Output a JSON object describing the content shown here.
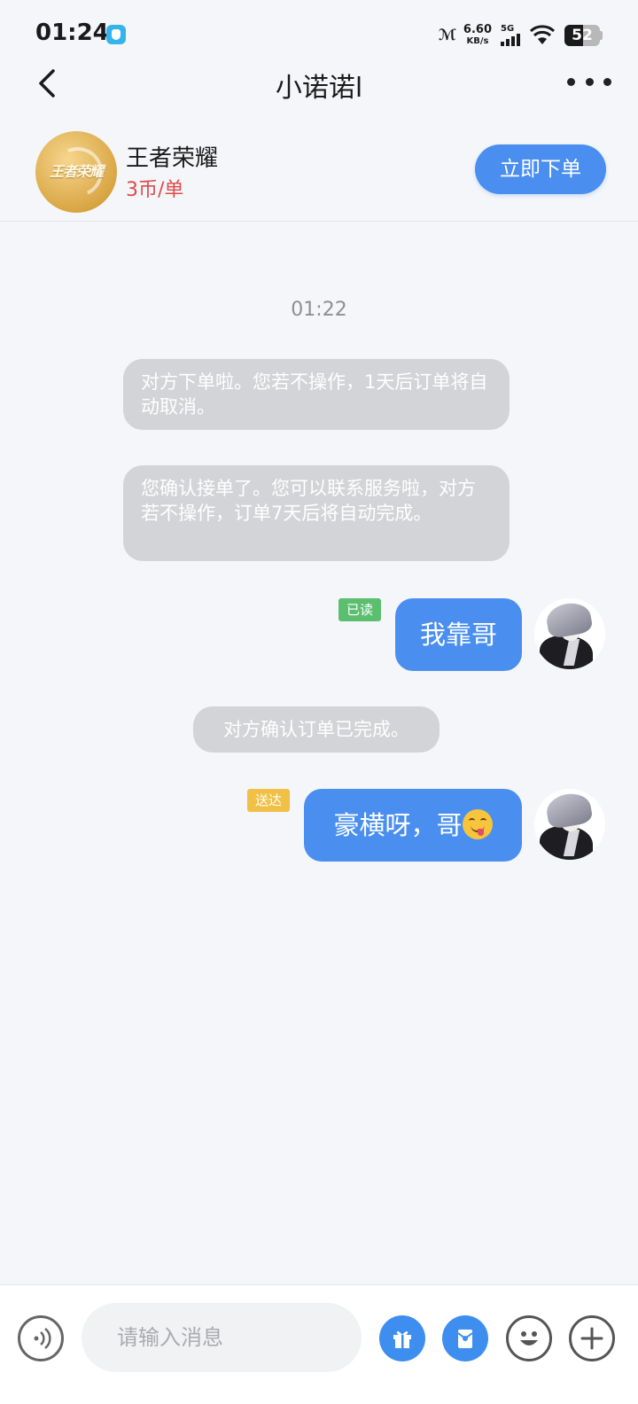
{
  "status_bar": {
    "time": "01:24",
    "nfc": "ℳ",
    "net_speed": "6.60",
    "net_unit": "KB/s",
    "network": "5G",
    "battery": "52",
    "battery_level": 0.52
  },
  "header": {
    "title": "小诺诺l"
  },
  "product": {
    "logo_text": "王者荣耀",
    "name": "王者荣耀",
    "price": "3币/单",
    "order_button_label": "立即下单"
  },
  "chat": {
    "timestamp": "01:22",
    "system_messages": [
      "对方下单啦。您若不操作，1天后订单将自动取消。",
      "您确认接单了。您可以联系服务啦，对方若不操作，订单7天后将自动完成。",
      "对方确认订单已完成。"
    ],
    "messages": [
      {
        "text": "我靠哥",
        "status": "已读",
        "emoji": ""
      },
      {
        "text": "豪横呀，哥",
        "status": "送达",
        "emoji": "yum-face-icon"
      }
    ]
  },
  "input": {
    "placeholder": "请输入消息"
  },
  "colors": {
    "accent": "#4a8ff0",
    "price": "#e04b4b",
    "read_tag": "#5bbf6f",
    "sent_tag": "#f1c046",
    "system_bubble": "#d3d4d7"
  },
  "icons": [
    "back-arrow-icon",
    "more-dots-icon",
    "voice-icon",
    "gift-icon",
    "red-packet-icon",
    "emoji-icon",
    "plus-icon"
  ]
}
